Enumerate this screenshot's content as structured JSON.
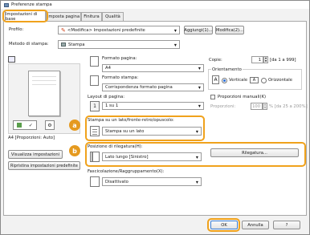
{
  "window": {
    "title": "Preferenze stampa"
  },
  "tabs": [
    {
      "label": "Impostazioni di base"
    },
    {
      "label": "Imposta pagina"
    },
    {
      "label": "Finitura"
    },
    {
      "label": "Qualità"
    }
  ],
  "profile": {
    "label": "Profilo:",
    "value": "<Modifica> Impostazioni predefinite",
    "add_button": "Aggiungi(1)...",
    "edit_button": "Modifica(2)..."
  },
  "output_method": {
    "label": "Metodo di stampa:",
    "value": "Stampa"
  },
  "preview": {
    "caption": "A4 [Proporzioni: Auto]"
  },
  "left_buttons": {
    "view_settings": "Visualizza impostazioni",
    "restore_defaults": "Ripristina impostazioni predefinite"
  },
  "page_size": {
    "label": "Formato pagina:",
    "value": "A4"
  },
  "output_size": {
    "label": "Formato stampa:",
    "value": "Corrispondenza formato pagina"
  },
  "page_layout": {
    "label": "Layout di pagina:",
    "value": "1 su 1"
  },
  "copies": {
    "label": "Copie:",
    "value": "1",
    "range": "[da 1 a 999]"
  },
  "orientation": {
    "legend": "Orientamento",
    "portrait_label": "Verticale",
    "landscape_label": "Orizzontale",
    "selected": "Verticale"
  },
  "manual_scaling": {
    "label": "Proporzioni manuali(K)",
    "checked": false,
    "scaling_label": "Proporzioni:",
    "scaling_value": "100",
    "scaling_range": "% [da 25 a 200%]"
  },
  "duplex": {
    "label": "Stampa su un lato/fronte-retro/opuscolo:",
    "value": "Stampa su un lato",
    "badge": "a"
  },
  "binding": {
    "label": "Posizione di rilegatura(H):",
    "value": "Lato lungo [Sinistro]",
    "button": "Rilegatura...",
    "badge": "b"
  },
  "collate": {
    "label": "Fascicolazione/Raggruppamento(X):",
    "value": "Disattivato"
  },
  "footer": {
    "ok": "OK",
    "cancel": "Annulla",
    "help": "?"
  },
  "colors": {
    "highlight": "#f0a21c",
    "badge": "#e59a1f"
  }
}
